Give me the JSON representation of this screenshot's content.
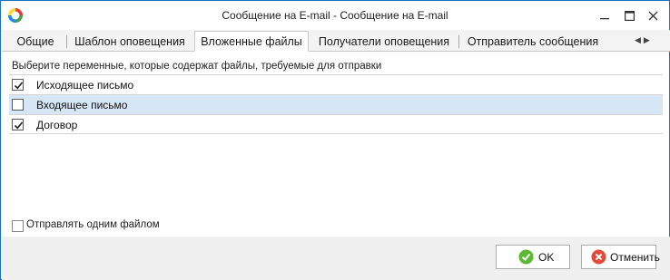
{
  "window": {
    "title": "Сообщение на E-mail - Сообщение на E-mail"
  },
  "tabs": [
    {
      "label": "Общие"
    },
    {
      "label": "Шаблон оповещения"
    },
    {
      "label": "Вложенные файлы"
    },
    {
      "label": "Получатели оповещения"
    },
    {
      "label": "Отправитель сообщения"
    }
  ],
  "active_tab": "Вложенные файлы",
  "content": {
    "instruction": "Выберите переменные, которые содержат файлы, требуемые для отправки",
    "items": [
      {
        "label": "Исходящее письмо",
        "checked": true
      },
      {
        "label": "Входящее письмо",
        "checked": false,
        "selected": true
      },
      {
        "label": "Договор",
        "checked": true
      }
    ],
    "single_file": {
      "label": "Отправлять одним файлом",
      "checked": false
    }
  },
  "footer": {
    "ok_label": "OK",
    "cancel_label": "Отменить"
  },
  "colors": {
    "selection": "#d6e6f5",
    "window_border": "#1f6fc4",
    "ok_icon": "#5cb833",
    "cancel_icon": "#e24b3b"
  }
}
